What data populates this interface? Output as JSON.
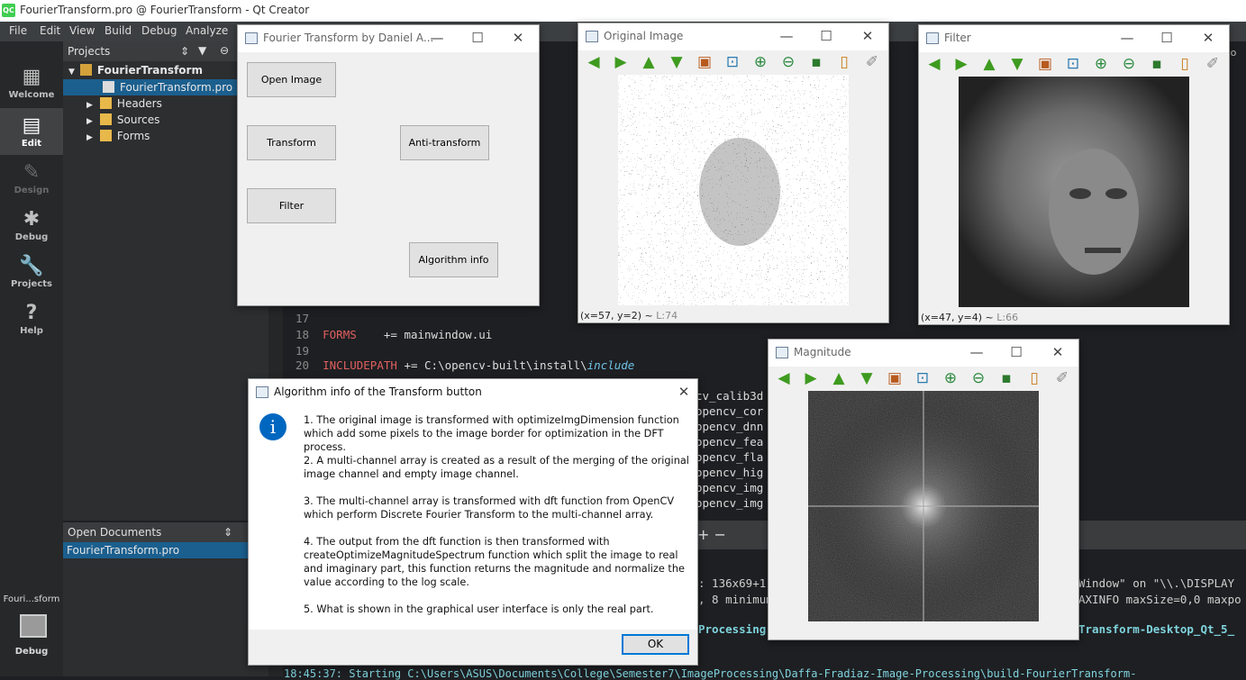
{
  "qt": {
    "title": "FourierTransform.pro @ FourierTransform - Qt Creator",
    "logo": "QC",
    "menu": [
      "File",
      "Edit",
      "View",
      "Build",
      "Debug",
      "Analyze"
    ],
    "modes": [
      {
        "label": "Welcome",
        "icon": "grid-icon"
      },
      {
        "label": "Edit",
        "icon": "edit-icon"
      },
      {
        "label": "Design",
        "icon": "pencil-icon"
      },
      {
        "label": "Debug",
        "icon": "bug-icon"
      },
      {
        "label": "Projects",
        "icon": "wrench-icon"
      },
      {
        "label": "Help",
        "icon": "help-icon"
      }
    ],
    "projects_header": "Projects",
    "tree": {
      "root": "FourierTransform",
      "items": [
        "FourierTransform.pro",
        "Headers",
        "Sources",
        "Forms"
      ]
    },
    "open_docs_header": "Open Documents",
    "open_docs": [
      "FourierTransform.pro"
    ],
    "target_name": "Fouri...sform",
    "target_mode": "Debug",
    "code": {
      "l17": "17",
      "l18": "18",
      "l19": "19",
      "l20": "20",
      "forms_kw": "FORMS",
      "forms_rest": "    += mainwindow.ui",
      "incl_kw": "INCLUDEPATH",
      "incl_rest": " += C:\\opencv-built\\install\\",
      "incl_it": "include",
      "libs": [
        "cv_calib3d",
        "opencv_cor",
        "opencv_dnn",
        "opencv_fea",
        "opencv_fla",
        "opencv_hig",
        "opencv_img",
        "opencv_img"
      ],
      "right_out1": "Window\" on \"\\\\.\\DISPLAY",
      "right_out2": "AXINFO maxSize=0,0 maxpo",
      "left_out1": ": 136x69+1",
      "left_out2": ", 8 minimum",
      "right_out3": "Transform-Desktop_Qt_5_",
      "processing": "Processing",
      "bottom_line": "18:45:37: Starting C:\\Users\\ASUS\\Documents\\College\\Semester7\\ImageProcessing\\Daffa-Fradiaz-Image-Processing\\build-FourierTransform-",
      "plus_minus": "+ −",
      "window_cut": "Windo"
    }
  },
  "main_window": {
    "title": "Fourier Transform by Daniel A...",
    "buttons": {
      "open": "Open Image",
      "transform": "Transform",
      "anti": "Anti-transform",
      "filter": "Filter",
      "algo": "Algorithm info"
    }
  },
  "original": {
    "title": "Original Image",
    "status": "(x=57, y=2) ~ ",
    "status_gray": "L:74"
  },
  "filter_win": {
    "title": "Filter",
    "status": "(x=47, y=4) ~ ",
    "status_gray": "L:66"
  },
  "magnitude": {
    "title": "Magnitude"
  },
  "info": {
    "title": "Algorithm info of the Transform button",
    "info_glyph": "i",
    "paragraphs": [
      "1. The original image is transformed with optimizeImgDimension function which add some pixels to the image border for optimization in the DFT process.",
      "2. A multi-channel array is created as a result of the merging of the original image channel and empty image channel.",
      "3. The multi-channel array is transformed with dft function from OpenCV which perform Discrete Fourier Transform to the multi-channel array.",
      "4. The output from the dft function is then transformed with createOptimizeMagnitudeSpectrum function which split the image to real and imaginary part, this function returns the magnitude and normalize the value according to the log scale.",
      "5. What is shown in the graphical user interface is only the real part."
    ],
    "ok": "OK"
  },
  "colors": {
    "qt_green": "#41cd52",
    "info_blue": "#0067c0",
    "arrow_green": "#3e9b1f"
  }
}
